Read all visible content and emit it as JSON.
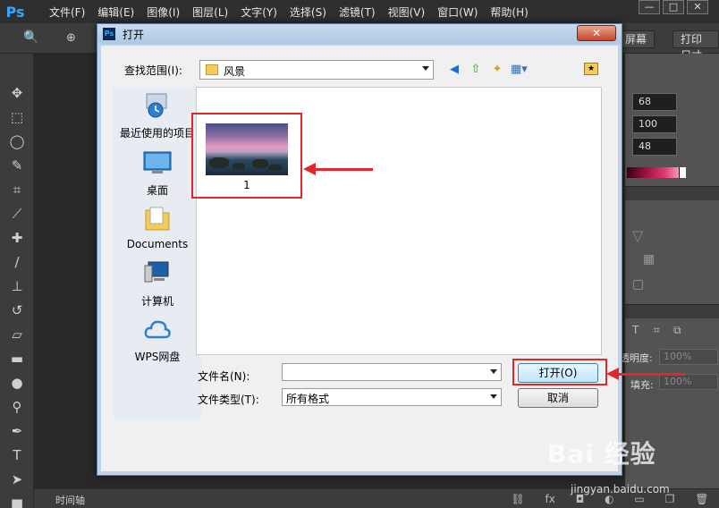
{
  "ps": {
    "logo": "Ps",
    "menu": [
      "文件(F)",
      "编辑(E)",
      "图像(I)",
      "图层(L)",
      "文字(Y)",
      "选择(S)",
      "滤镜(T)",
      "视图(V)",
      "窗口(W)",
      "帮助(H)"
    ],
    "window_buttons": [
      "—",
      "□",
      "✕"
    ],
    "options_buttons": [
      "屏幕",
      "打印尺寸"
    ],
    "right_panel": {
      "values": [
        "68",
        "100",
        "48"
      ],
      "opacity_label": "透明度:",
      "opacity_value": "100%",
      "fill_label": "填充:",
      "fill_value": "100%"
    },
    "timeline_label": "时间轴"
  },
  "dialog": {
    "title": "打开",
    "close_label": "✕",
    "lookin_label": "查找范围(I):",
    "lookin_value": "风景",
    "places": [
      {
        "label": "最近使用的项目",
        "icon": "recent-items-icon"
      },
      {
        "label": "桌面",
        "icon": "desktop-icon"
      },
      {
        "label": "Documents",
        "icon": "documents-folder-icon"
      },
      {
        "label": "计算机",
        "icon": "computer-icon"
      },
      {
        "label": "WPS网盘",
        "icon": "cloud-drive-icon"
      }
    ],
    "file": {
      "name": "1"
    },
    "filename_label": "文件名(N):",
    "filename_value": "",
    "filetype_label": "文件类型(T):",
    "filetype_value": "所有格式",
    "open_button": "打开(O)",
    "cancel_button": "取消"
  },
  "watermark": {
    "main": "Bai 经验",
    "sub": "jingyan.baidu.com"
  },
  "colors": {
    "annotation_red": "#e1262c",
    "dialog_border": "#5b7da6",
    "ps_dark": "#2f2f2f"
  }
}
